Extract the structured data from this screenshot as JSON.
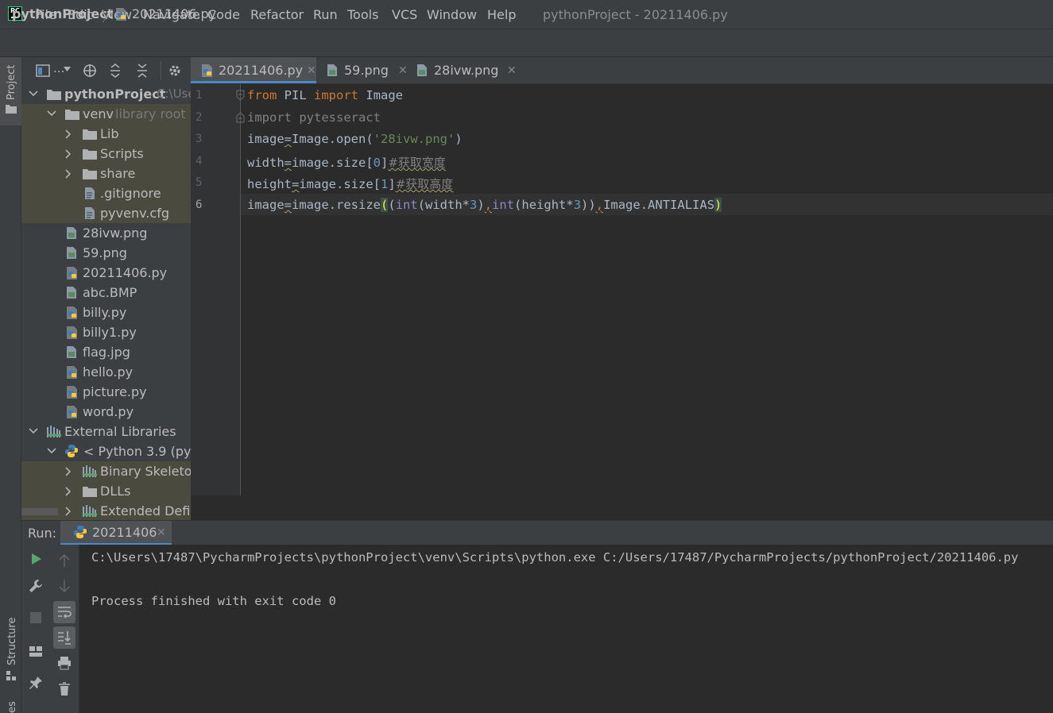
{
  "menu": {
    "items": [
      "File",
      "Edit",
      "View",
      "Navigate",
      "Code",
      "Refactor",
      "Run",
      "Tools",
      "VCS",
      "Window",
      "Help"
    ],
    "window_title": "pythonProject - 20211406.py"
  },
  "breadcrumb": {
    "project": "pythonProject",
    "file": "20211406.py"
  },
  "left_strip": {
    "project_tab": "Project",
    "structure_tab": "Structure",
    "bottom_tab": "es"
  },
  "project_panel": {
    "toolbar_more": "...",
    "root": {
      "label": "pythonProject",
      "path": "C:\\Use"
    },
    "venv": {
      "label": "venv",
      "hint": "library root"
    },
    "venv_children": [
      "Lib",
      "Scripts",
      "share",
      ".gitignore",
      "pyvenv.cfg"
    ],
    "files": [
      "28ivw.png",
      "59.png",
      "20211406.py",
      "abc.BMP",
      "billy.py",
      "billy1.py",
      "flag.jpg",
      "hello.py",
      "picture.py",
      "word.py"
    ],
    "external": "External Libraries",
    "python": "< Python 3.9 (pyth",
    "python_children": [
      "Binary Skeleton",
      "DLLs",
      "Extended Defini"
    ]
  },
  "editor": {
    "tabs": [
      "20211406.py",
      "59.png",
      "28ivw.png"
    ],
    "line_numbers": [
      "1",
      "2",
      "3",
      "4",
      "5",
      "6"
    ],
    "code": {
      "l1_kw1": "from",
      "l1_mod": " PIL ",
      "l1_kw2": "import",
      "l1_name": " Image",
      "l2": "import pytesseract",
      "l3_var": "image",
      "l3_eq": "=",
      "l3_call": "Image.open(",
      "l3_str": "'28ivw.png'",
      "l3_end": ")",
      "l4_var": "width",
      "l4_eq": "=",
      "l4_call": "image.size[",
      "l4_num": "0",
      "l4_close": "]",
      "l4_cmt": "#获取宽度",
      "l5_var": "height",
      "l5_eq": "=",
      "l5_call": "image.size[",
      "l5_num": "1",
      "l5_close": "]",
      "l5_cmt": "#获取高度",
      "l6_var": "image",
      "l6_eq": "=",
      "l6_call": "image.resize",
      "l6_open": "(",
      "l6_a": "(",
      "l6_int1": "int",
      "l6_b": "(width*",
      "l6_n1": "3",
      "l6_c": ")",
      "l6_comma1": ",",
      "l6_int2": "int",
      "l6_d": "(height*",
      "l6_n2": "3",
      "l6_e": "))",
      "l6_comma2": ",",
      "l6_f": "Image.ANTIALIAS",
      "l6_close": ")"
    }
  },
  "run": {
    "label": "Run:",
    "tab": "20211406",
    "console": [
      "C:\\Users\\17487\\PycharmProjects\\pythonProject\\venv\\Scripts\\python.exe C:/Users/17487/PycharmProjects/pythonProject/20211406.py",
      "",
      "Process finished with exit code 0"
    ]
  },
  "colors": {
    "accent": "#4a88c7",
    "keyword": "#cc7832",
    "string": "#6a8759",
    "number": "#6897bb",
    "run_green": "#59a869"
  }
}
